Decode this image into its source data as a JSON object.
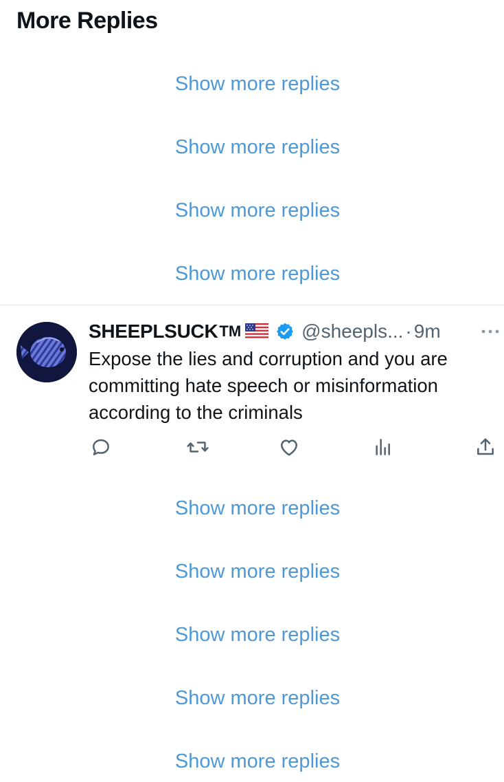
{
  "section": {
    "title": "More Replies"
  },
  "replies_above": [
    {
      "label": "Show more replies"
    },
    {
      "label": "Show more replies"
    },
    {
      "label": "Show more replies"
    },
    {
      "label": "Show more replies"
    }
  ],
  "tweet": {
    "display_name": "SHEEPLSUCK",
    "trademark": "TM",
    "flag_icon": "us-flag-icon",
    "verified_icon": "verified-badge-icon",
    "handle": "@sheepls...",
    "separator": "·",
    "time": "9m",
    "text": "Expose the lies and corruption and you are committing hate speech or misinformation according to the criminals",
    "actions": {
      "reply_icon": "reply-icon",
      "retweet_icon": "retweet-icon",
      "like_icon": "heart-icon",
      "views_icon": "views-chart-icon",
      "share_icon": "share-icon"
    }
  },
  "replies_below": [
    {
      "label": "Show more replies"
    },
    {
      "label": "Show more replies"
    },
    {
      "label": "Show more replies"
    },
    {
      "label": "Show more replies"
    },
    {
      "label": "Show more replies"
    }
  ],
  "colors": {
    "link": "#4d98d6",
    "text": "#0f1419",
    "secondary": "#536471",
    "verified": "#1d9bf0",
    "divider": "#dcdfe3"
  }
}
